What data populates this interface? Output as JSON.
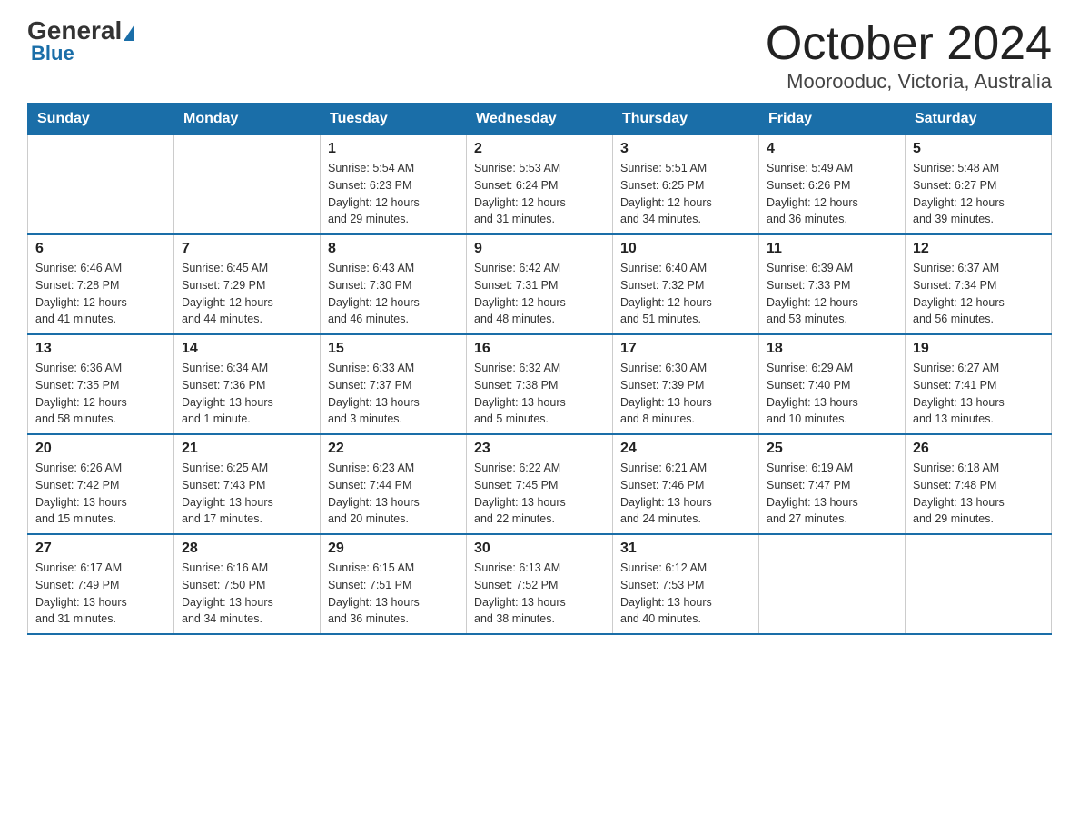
{
  "logo": {
    "part1": "General",
    "part2": "Blue"
  },
  "title": "October 2024",
  "subtitle": "Moorooduc, Victoria, Australia",
  "days_of_week": [
    "Sunday",
    "Monday",
    "Tuesday",
    "Wednesday",
    "Thursday",
    "Friday",
    "Saturday"
  ],
  "weeks": [
    [
      {
        "day": "",
        "info": ""
      },
      {
        "day": "",
        "info": ""
      },
      {
        "day": "1",
        "info": "Sunrise: 5:54 AM\nSunset: 6:23 PM\nDaylight: 12 hours\nand 29 minutes."
      },
      {
        "day": "2",
        "info": "Sunrise: 5:53 AM\nSunset: 6:24 PM\nDaylight: 12 hours\nand 31 minutes."
      },
      {
        "day": "3",
        "info": "Sunrise: 5:51 AM\nSunset: 6:25 PM\nDaylight: 12 hours\nand 34 minutes."
      },
      {
        "day": "4",
        "info": "Sunrise: 5:49 AM\nSunset: 6:26 PM\nDaylight: 12 hours\nand 36 minutes."
      },
      {
        "day": "5",
        "info": "Sunrise: 5:48 AM\nSunset: 6:27 PM\nDaylight: 12 hours\nand 39 minutes."
      }
    ],
    [
      {
        "day": "6",
        "info": "Sunrise: 6:46 AM\nSunset: 7:28 PM\nDaylight: 12 hours\nand 41 minutes."
      },
      {
        "day": "7",
        "info": "Sunrise: 6:45 AM\nSunset: 7:29 PM\nDaylight: 12 hours\nand 44 minutes."
      },
      {
        "day": "8",
        "info": "Sunrise: 6:43 AM\nSunset: 7:30 PM\nDaylight: 12 hours\nand 46 minutes."
      },
      {
        "day": "9",
        "info": "Sunrise: 6:42 AM\nSunset: 7:31 PM\nDaylight: 12 hours\nand 48 minutes."
      },
      {
        "day": "10",
        "info": "Sunrise: 6:40 AM\nSunset: 7:32 PM\nDaylight: 12 hours\nand 51 minutes."
      },
      {
        "day": "11",
        "info": "Sunrise: 6:39 AM\nSunset: 7:33 PM\nDaylight: 12 hours\nand 53 minutes."
      },
      {
        "day": "12",
        "info": "Sunrise: 6:37 AM\nSunset: 7:34 PM\nDaylight: 12 hours\nand 56 minutes."
      }
    ],
    [
      {
        "day": "13",
        "info": "Sunrise: 6:36 AM\nSunset: 7:35 PM\nDaylight: 12 hours\nand 58 minutes."
      },
      {
        "day": "14",
        "info": "Sunrise: 6:34 AM\nSunset: 7:36 PM\nDaylight: 13 hours\nand 1 minute."
      },
      {
        "day": "15",
        "info": "Sunrise: 6:33 AM\nSunset: 7:37 PM\nDaylight: 13 hours\nand 3 minutes."
      },
      {
        "day": "16",
        "info": "Sunrise: 6:32 AM\nSunset: 7:38 PM\nDaylight: 13 hours\nand 5 minutes."
      },
      {
        "day": "17",
        "info": "Sunrise: 6:30 AM\nSunset: 7:39 PM\nDaylight: 13 hours\nand 8 minutes."
      },
      {
        "day": "18",
        "info": "Sunrise: 6:29 AM\nSunset: 7:40 PM\nDaylight: 13 hours\nand 10 minutes."
      },
      {
        "day": "19",
        "info": "Sunrise: 6:27 AM\nSunset: 7:41 PM\nDaylight: 13 hours\nand 13 minutes."
      }
    ],
    [
      {
        "day": "20",
        "info": "Sunrise: 6:26 AM\nSunset: 7:42 PM\nDaylight: 13 hours\nand 15 minutes."
      },
      {
        "day": "21",
        "info": "Sunrise: 6:25 AM\nSunset: 7:43 PM\nDaylight: 13 hours\nand 17 minutes."
      },
      {
        "day": "22",
        "info": "Sunrise: 6:23 AM\nSunset: 7:44 PM\nDaylight: 13 hours\nand 20 minutes."
      },
      {
        "day": "23",
        "info": "Sunrise: 6:22 AM\nSunset: 7:45 PM\nDaylight: 13 hours\nand 22 minutes."
      },
      {
        "day": "24",
        "info": "Sunrise: 6:21 AM\nSunset: 7:46 PM\nDaylight: 13 hours\nand 24 minutes."
      },
      {
        "day": "25",
        "info": "Sunrise: 6:19 AM\nSunset: 7:47 PM\nDaylight: 13 hours\nand 27 minutes."
      },
      {
        "day": "26",
        "info": "Sunrise: 6:18 AM\nSunset: 7:48 PM\nDaylight: 13 hours\nand 29 minutes."
      }
    ],
    [
      {
        "day": "27",
        "info": "Sunrise: 6:17 AM\nSunset: 7:49 PM\nDaylight: 13 hours\nand 31 minutes."
      },
      {
        "day": "28",
        "info": "Sunrise: 6:16 AM\nSunset: 7:50 PM\nDaylight: 13 hours\nand 34 minutes."
      },
      {
        "day": "29",
        "info": "Sunrise: 6:15 AM\nSunset: 7:51 PM\nDaylight: 13 hours\nand 36 minutes."
      },
      {
        "day": "30",
        "info": "Sunrise: 6:13 AM\nSunset: 7:52 PM\nDaylight: 13 hours\nand 38 minutes."
      },
      {
        "day": "31",
        "info": "Sunrise: 6:12 AM\nSunset: 7:53 PM\nDaylight: 13 hours\nand 40 minutes."
      },
      {
        "day": "",
        "info": ""
      },
      {
        "day": "",
        "info": ""
      }
    ]
  ]
}
